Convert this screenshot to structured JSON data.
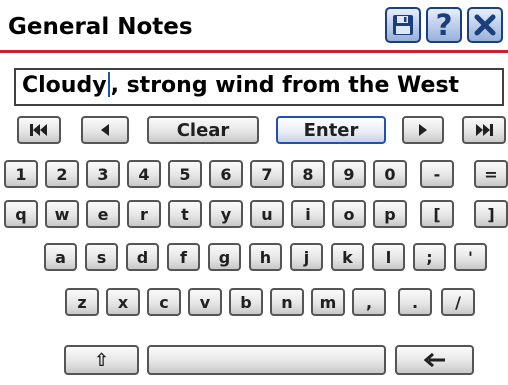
{
  "header": {
    "title": "General Notes",
    "buttons": [
      {
        "name": "save-icon"
      },
      {
        "name": "help-icon",
        "glyph": "?"
      },
      {
        "name": "close-icon"
      }
    ],
    "accent_color": "#c9202c",
    "button_color": "#1b3f7d"
  },
  "input": {
    "text_before_caret": "Cloudy",
    "text_after_caret": ",  strong wind from the West"
  },
  "keyboard": {
    "nav_row": {
      "first": "first-icon",
      "prev": "left-arrow-icon",
      "clear": "Clear",
      "enter": "Enter",
      "next": "right-arrow-icon",
      "last": "last-icon"
    },
    "number_row": [
      "1",
      "2",
      "3",
      "4",
      "5",
      "6",
      "7",
      "8",
      "9",
      "0",
      "-",
      "="
    ],
    "row_q": [
      "q",
      "w",
      "e",
      "r",
      "t",
      "y",
      "u",
      "i",
      "o",
      "p",
      "[",
      "]"
    ],
    "row_a": [
      "a",
      "s",
      "d",
      "f",
      "g",
      "h",
      "j",
      "k",
      "l",
      ";",
      "'"
    ],
    "row_z": [
      "z",
      "x",
      "c",
      "v",
      "b",
      "n",
      "m",
      ",",
      ".",
      "/"
    ],
    "bottom_row": {
      "shift": "⇧",
      "space": "",
      "backspace": "back-arrow-icon"
    }
  }
}
